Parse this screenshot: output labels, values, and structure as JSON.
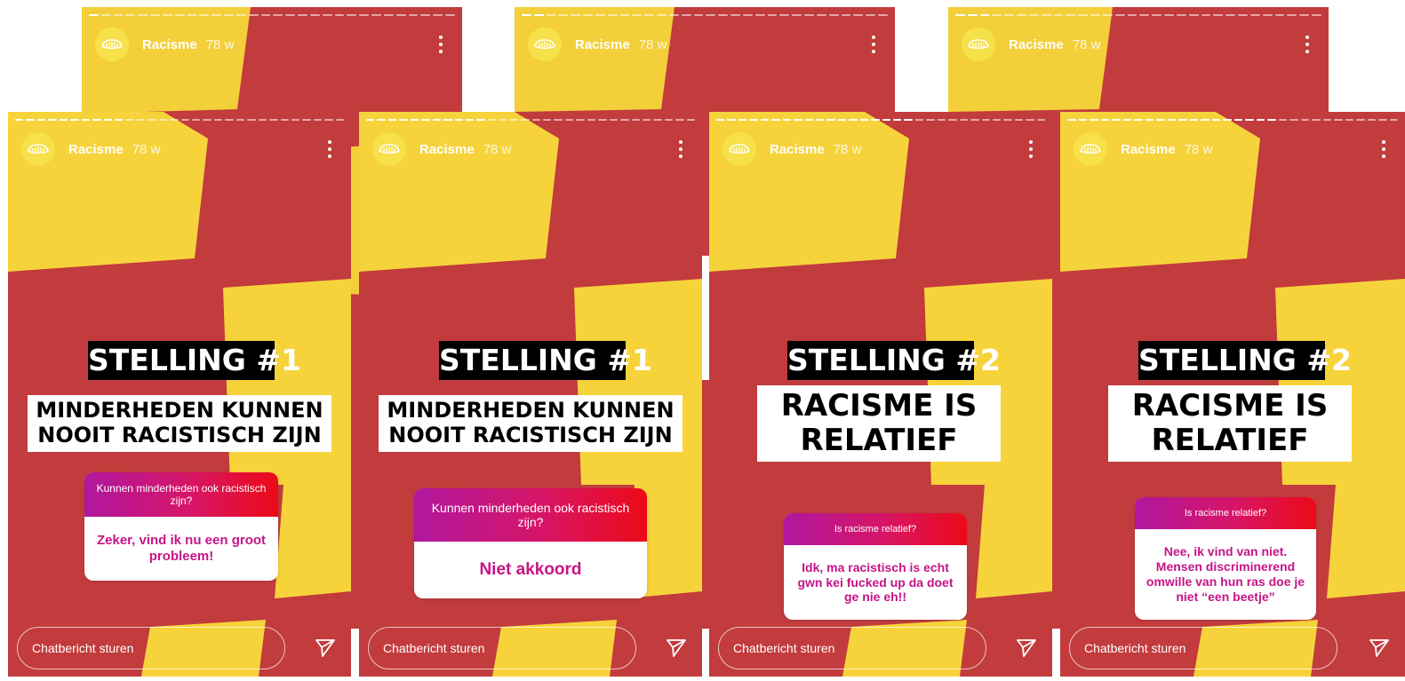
{
  "account": {
    "name": "Racisme",
    "age": "78 w"
  },
  "chat_placeholder": "Chatbericht sturen",
  "colors": {
    "red": "#c23b3d",
    "yellow": "#f6d33b",
    "question_gradient": [
      "#b0179f",
      "#ec0a17"
    ],
    "answer_text": "#c61487"
  },
  "icons": {
    "more": "more-vertical-icon",
    "send": "send-icon",
    "avatar": "hands-logo-icon"
  },
  "stories": [
    {
      "title": "STELLING #1",
      "statement": "MINDERHEDEN KUNNEN NOOIT RACISTISCH ZIJN",
      "question": "Kunnen minderheden ook racistisch zijn?",
      "answer": "Zeker, vind ik nu een groot probleem!"
    },
    {
      "title": "STELLING #1",
      "statement": "MINDERHEDEN KUNNEN NOOIT RACISTISCH ZIJN",
      "question": "Kunnen minderheden ook racistisch zijn?",
      "answer": "Niet akkoord"
    },
    {
      "title": "STELLING #2",
      "statement": "RACISME IS RELATIEF",
      "question": "Is racisme relatief?",
      "answer": "Idk, ma racistisch is echt gwn kei fucked up da doet ge nie eh!!"
    },
    {
      "title": "STELLING #2",
      "statement": "RACISME IS RELATIEF",
      "question": "Is racisme relatief?",
      "answer": "Nee, ik vind van niet. Mensen discriminerend omwille van hun ras doe je niet “een beetje”"
    }
  ]
}
